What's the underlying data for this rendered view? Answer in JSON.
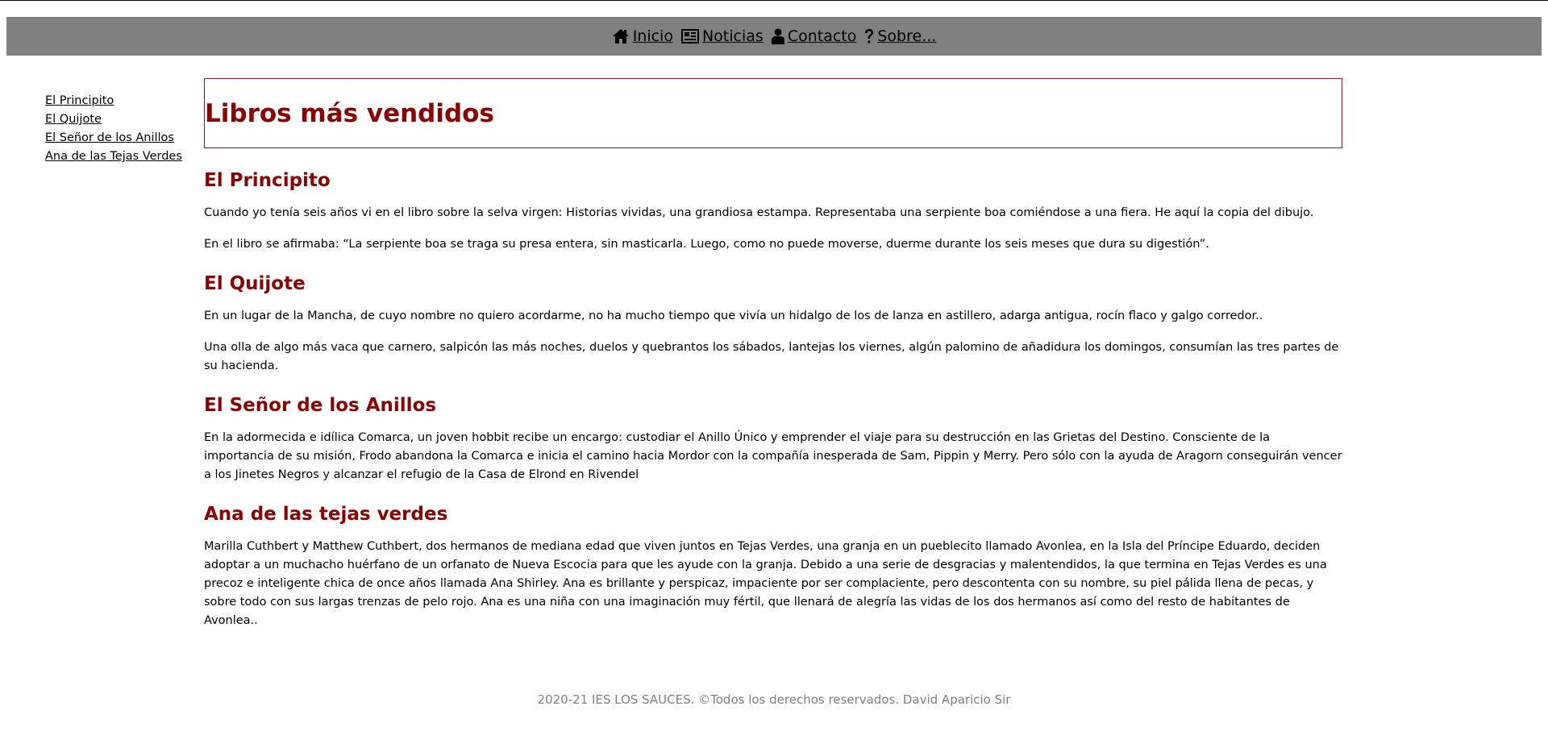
{
  "nav": {
    "items": [
      {
        "label": "Inicio",
        "icon": "home-icon"
      },
      {
        "label": "Noticias",
        "icon": "newspaper-icon"
      },
      {
        "label": "Contacto",
        "icon": "user-icon"
      },
      {
        "label": "Sobre...",
        "icon": "question-icon"
      }
    ]
  },
  "sidebar": {
    "links": [
      "El Principito",
      "El Quijote",
      "El Señor de los Anillos",
      "Ana de las Tejas Verdes"
    ]
  },
  "main": {
    "title": "Libros más vendidos",
    "sections": [
      {
        "heading": "El Principito",
        "paragraphs": [
          "Cuando yo tenía seis años vi en el libro sobre la selva virgen: Historias vividas, una grandiosa estampa. Representaba una serpiente boa comiéndose a una fiera. He aquí la copia del dibujo.",
          "En el libro se afirmaba: “La serpiente boa se traga su presa entera, sin masticarla. Luego, como no puede moverse, duerme durante los seis meses que dura su digestión”."
        ]
      },
      {
        "heading": "El Quijote",
        "paragraphs": [
          "En un lugar de la Mancha, de cuyo nombre no quiero acordarme, no ha mucho tiempo que vivía un hidalgo de los de lanza en astillero, adarga antigua, rocín flaco y galgo corredor..",
          "Una olla de algo más vaca que carnero, salpicón las más noches, duelos y quebrantos los sábados, lantejas los viernes, algún palomino de añadidura los domingos, consumían las tres partes de su hacienda."
        ]
      },
      {
        "heading": "El Señor de los Anillos",
        "paragraphs": [
          "En la adormecida e idílica Comarca, un joven hobbit recibe un encargo: custodiar el Anillo Único y emprender el viaje para su destrucción en las Grietas del Destino. Consciente de la importancia de su misión, Frodo abandona la Comarca e inicia el camino hacia Mordor con la compañía inesperada de Sam, Pippin y Merry. Pero sólo con la ayuda de Aragorn conseguirán vencer a los Jinetes Negros y alcanzar el refugio de la Casa de Elrond en Rivendel"
        ]
      },
      {
        "heading": "Ana de las tejas verdes",
        "paragraphs": [
          "Marilla Cuthbert y Matthew Cuthbert, dos hermanos de mediana edad que viven juntos en Tejas Verdes, una granja en un pueblecito llamado Avonlea, en la Isla del Príncipe Eduardo, deciden adoptar a un muchacho huérfano de un orfanato de Nueva Escocia para que les ayude con la granja. Debido a una serie de desgracias y malentendidos, la que termina en Tejas Verdes es una precoz e inteligente chica de once años llamada Ana Shirley. Ana es brillante y perspicaz, impaciente por ser complaciente, pero descontenta con su nombre, su piel pálida llena de pecas, y sobre todo con sus largas trenzas de pelo rojo. Ana es una niña con una imaginación muy fértil, que llenará de alegría las vidas de los dos hermanos así como del resto de habitantes de Avonlea.."
        ]
      }
    ]
  },
  "footer": {
    "text": "2020-21 IES LOS SAUCES. ©Todos los derechos reservados. David Aparicio Sir"
  },
  "colors": {
    "navbar_bg": "#808080",
    "heading": "#8b0000",
    "title_border": "#a01010",
    "footer_text": "#808080"
  }
}
